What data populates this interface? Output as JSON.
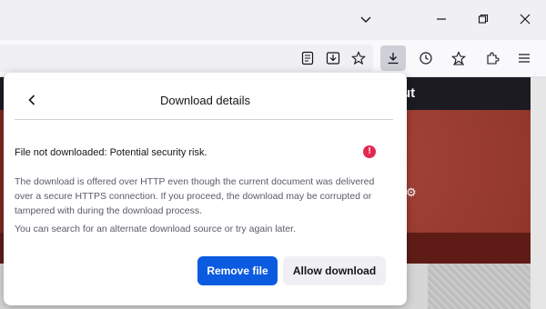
{
  "panel": {
    "title": "Download details",
    "status_text": "File not downloaded: Potential security risk.",
    "description": "The download is offered over HTTP even though the current document was delivered over a secure HTTPS connection. If you proceed, the download may be corrupted or tampered with during the download process.",
    "hint": "You can search for an alternate download source or try again later.",
    "warning_icon": "!",
    "buttons": {
      "remove": "Remove file",
      "allow": "Allow download"
    }
  },
  "page": {
    "header_fragment": "ut"
  },
  "colors": {
    "primary_button": "#0b5be0",
    "warning": "#e22850",
    "page_red": "#8e3329",
    "page_dark": "#1c1b22"
  },
  "icons": {
    "titlebar": [
      "chevron-down-icon",
      "minimize-icon",
      "restore-icon",
      "close-icon"
    ],
    "toolbar": [
      "reader-view-icon",
      "save-to-pocket-icon",
      "bookmark-star-icon",
      "downloads-icon",
      "history-icon",
      "bookmarks-icon",
      "extensions-icon",
      "menu-icon"
    ]
  }
}
